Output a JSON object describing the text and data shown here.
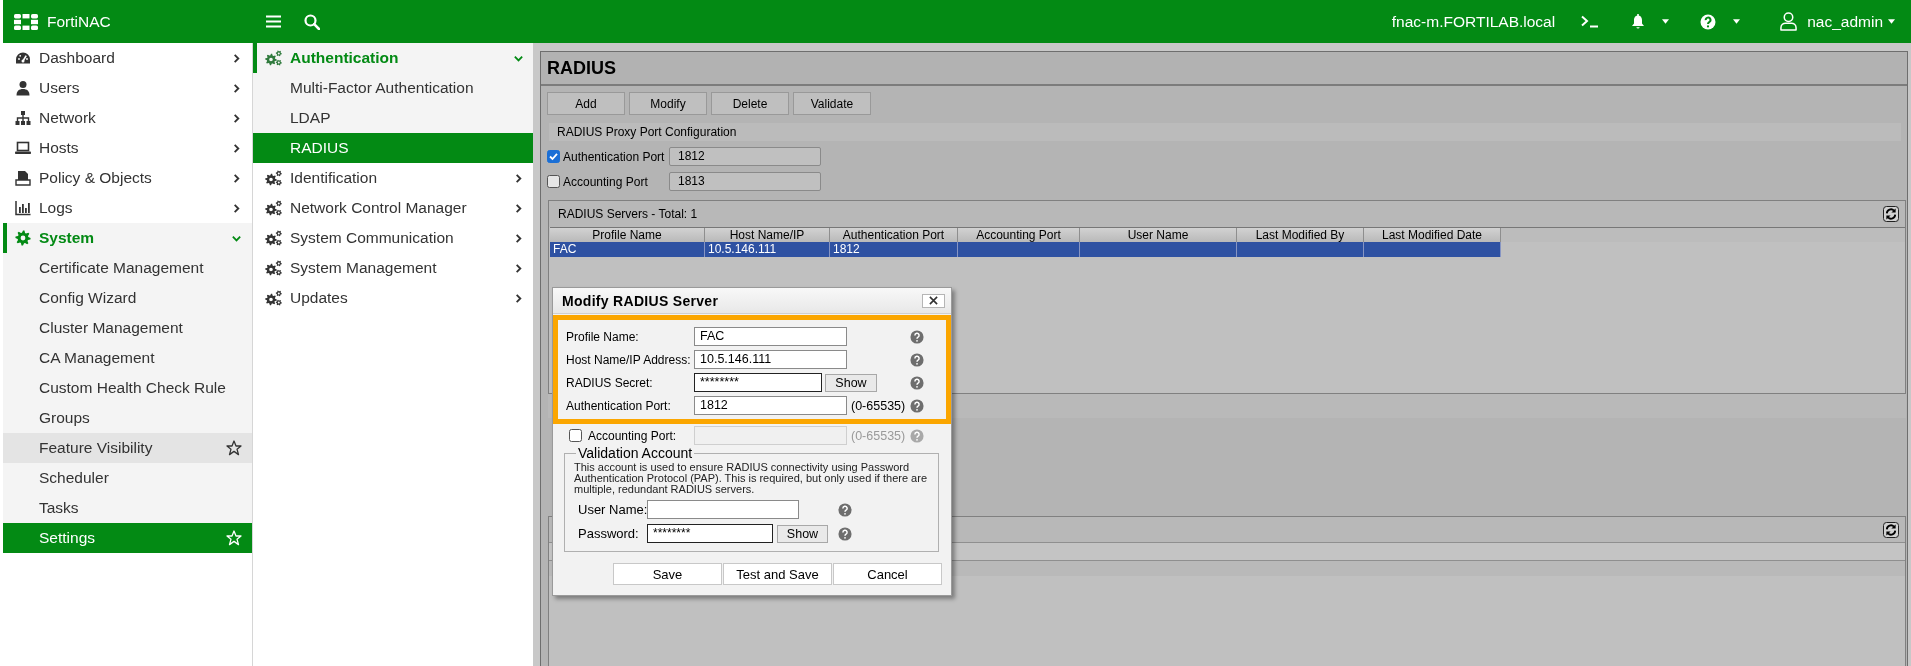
{
  "top_bar": {
    "product": "FortiNAC",
    "hostname": "fnac-m.FORTILAB.local",
    "user": "nac_admin"
  },
  "sidebar": {
    "items": [
      {
        "label": "Dashboard",
        "expanded": false
      },
      {
        "label": "Users",
        "expanded": false
      },
      {
        "label": "Network",
        "expanded": false
      },
      {
        "label": "Hosts",
        "expanded": false
      },
      {
        "label": "Policy & Objects",
        "expanded": false
      },
      {
        "label": "Logs",
        "expanded": false
      },
      {
        "label": "System",
        "expanded": true,
        "children": [
          {
            "label": "Certificate Management",
            "selected": false,
            "hovered": false
          },
          {
            "label": "Config Wizard",
            "selected": false,
            "hovered": false
          },
          {
            "label": "Cluster Management",
            "selected": false,
            "hovered": false
          },
          {
            "label": "CA Management",
            "selected": false,
            "hovered": false
          },
          {
            "label": "Custom Health Check Rule",
            "selected": false,
            "hovered": false
          },
          {
            "label": "Groups",
            "selected": false,
            "hovered": false
          },
          {
            "label": "Feature Visibility",
            "selected": false,
            "hovered": true
          },
          {
            "label": "Scheduler",
            "selected": false,
            "hovered": false
          },
          {
            "label": "Tasks",
            "selected": false,
            "hovered": false
          },
          {
            "label": "Settings",
            "selected": true,
            "hovered": false
          }
        ]
      }
    ]
  },
  "subnav": {
    "items": [
      {
        "label": "Authentication",
        "expanded": true,
        "children": [
          {
            "label": "Multi-Factor Authentication",
            "selected": false
          },
          {
            "label": "LDAP",
            "selected": false
          },
          {
            "label": "RADIUS",
            "selected": true
          }
        ]
      },
      {
        "label": "Identification",
        "expanded": false
      },
      {
        "label": "Network Control Manager",
        "expanded": false
      },
      {
        "label": "System Communication",
        "expanded": false
      },
      {
        "label": "System Management",
        "expanded": false
      },
      {
        "label": "Updates",
        "expanded": false
      }
    ]
  },
  "page": {
    "title": "RADIUS",
    "toolbar": [
      "Add",
      "Modify",
      "Delete",
      "Validate"
    ],
    "proxy_config": {
      "title": "RADIUS Proxy Port Configuration",
      "ports": [
        {
          "label": "Authentication Port",
          "checked": true,
          "value": "1812"
        },
        {
          "label": "Accounting Port",
          "checked": false,
          "value": "1813"
        }
      ]
    },
    "servers": {
      "title": "RADIUS Servers - Total: 1",
      "columns": [
        "Profile Name",
        "Host Name/IP",
        "Authentication Port",
        "Accounting Port",
        "User Name",
        "Last Modified By",
        "Last Modified Date"
      ],
      "rows": [
        {
          "selected": true,
          "cells": [
            "FAC",
            "10.5.146.111",
            "1812"
          ]
        }
      ]
    }
  },
  "dialog": {
    "title": "Modify RADIUS Server",
    "fields": [
      {
        "kind": "text",
        "label": "Profile Name:",
        "value": "FAC",
        "highlighted": true,
        "disabled": false
      },
      {
        "kind": "text",
        "label": "Host Name/IP Address:",
        "value": "10.5.146.111",
        "highlighted": true,
        "disabled": false
      },
      {
        "kind": "secret",
        "label": "RADIUS Secret:",
        "value": "********",
        "button": "Show",
        "highlighted": true,
        "disabled": false
      },
      {
        "kind": "text",
        "label": "Authentication Port:",
        "value": "1812",
        "hint": "(0-65535)",
        "highlighted": true,
        "disabled": false
      },
      {
        "kind": "optional",
        "label": "Accounting Port:",
        "checked": false,
        "hint": "(0-65535)",
        "highlighted": false,
        "disabled": true
      }
    ],
    "validation_account": {
      "title": "Validation Account",
      "description": "This account is used to ensure RADIUS connectivity using Password Authentication Protocol (PAP). This is required, but only used if there are multiple, redundant RADIUS servers.",
      "fields": [
        {
          "kind": "text",
          "label": "User Name:"
        },
        {
          "kind": "secret",
          "label": "Password:",
          "value": "********",
          "button": "Show"
        }
      ]
    },
    "buttons": [
      "Save",
      "Test and Save",
      "Cancel"
    ]
  }
}
